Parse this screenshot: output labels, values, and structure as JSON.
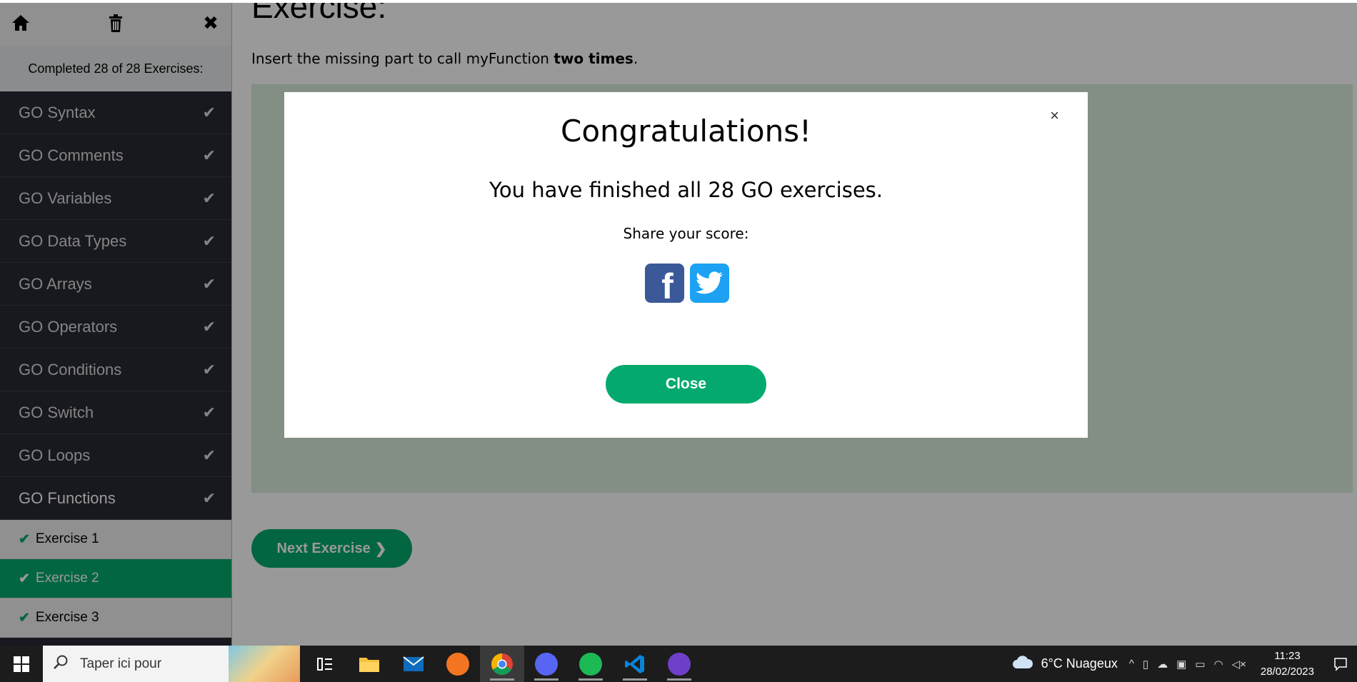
{
  "main": {
    "heading": "Exercise:",
    "instruction_prefix": "Insert the missing part to call myFunction ",
    "instruction_bold": "two times",
    "instruction_suffix": ".",
    "next_button": "Next Exercise"
  },
  "sidebar": {
    "completed": "Completed 28 of 28 Exercises:",
    "items": [
      {
        "label": "GO Syntax"
      },
      {
        "label": "GO Comments"
      },
      {
        "label": "GO Variables"
      },
      {
        "label": "GO Data Types"
      },
      {
        "label": "GO Arrays"
      },
      {
        "label": "GO Operators"
      },
      {
        "label": "GO Conditions"
      },
      {
        "label": "GO Switch"
      },
      {
        "label": "GO Loops"
      },
      {
        "label": "GO Functions"
      }
    ],
    "sub_items": [
      {
        "label": "Exercise 1"
      },
      {
        "label": "Exercise 2"
      },
      {
        "label": "Exercise 3"
      }
    ]
  },
  "modal": {
    "title": "Congratulations!",
    "message": "You have finished all 28 GO exercises.",
    "share_label": "Share your score:",
    "close_button": "Close",
    "close_x": "×"
  },
  "taskbar": {
    "search_placeholder": "Taper ici pour",
    "weather": "6°C  Nuageux",
    "time": "11:23",
    "date": "28/02/2023"
  },
  "colors": {
    "accent": "#04aa6d",
    "sidebar_bg": "#282a35",
    "facebook": "#3b5998",
    "twitter": "#1da1f2"
  }
}
